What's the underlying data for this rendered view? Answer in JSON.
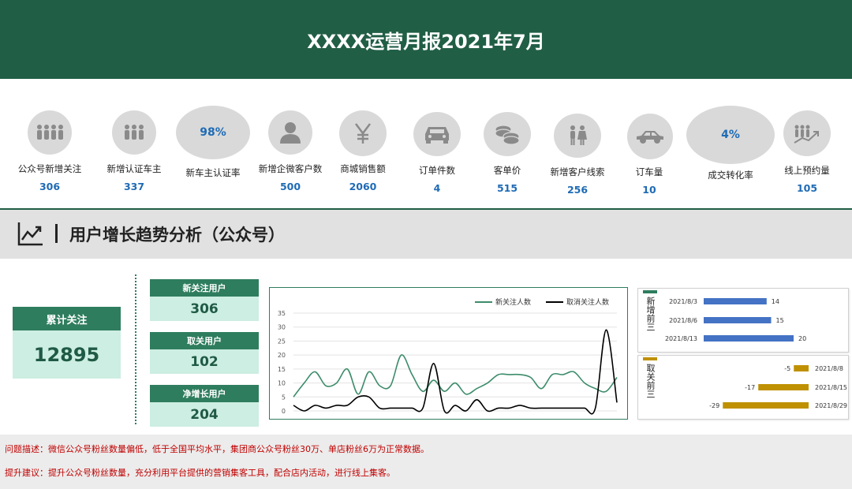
{
  "header": {
    "title": "XXXX运营月报2021年7月"
  },
  "kpis": [
    {
      "label": "公众号新增关注",
      "value": "306",
      "icon": "people-group-icon"
    },
    {
      "label": "新增认证车主",
      "value": "337",
      "icon": "people-group-icon"
    },
    {
      "label": "新车主认证率",
      "value": "98%",
      "icon": "percent-bubble"
    },
    {
      "label": "新增企微客户数",
      "value": "500",
      "icon": "user-icon"
    },
    {
      "label": "商城销售额",
      "value": "2060",
      "icon": "yen-icon"
    },
    {
      "label": "订单件数",
      "value": "4",
      "icon": "car-front-icon"
    },
    {
      "label": "客单价",
      "value": "515",
      "icon": "coins-icon"
    },
    {
      "label": "新增客户线索",
      "value": "256",
      "icon": "couple-icon"
    },
    {
      "label": "订车量",
      "value": "10",
      "icon": "car-side-icon"
    },
    {
      "label": "成交转化率",
      "value": "4%",
      "icon": "percent-bubble"
    },
    {
      "label": "线上预约量",
      "value": "105",
      "icon": "growth-people-icon"
    }
  ],
  "section": {
    "title": "用户增长趋势分析（公众号）"
  },
  "total": {
    "label": "累计关注",
    "value": "12895"
  },
  "mini": [
    {
      "label": "新关注用户",
      "value": "306"
    },
    {
      "label": "取关用户",
      "value": "102"
    },
    {
      "label": "净增长用户",
      "value": "204"
    }
  ],
  "notes": {
    "problem": "问题描述：微信公众号粉丝数量偏低，低于全国平均水平，集团商公众号粉丝30万、单店粉丝6万为正常数据。",
    "suggestion": "提升建议：提升公众号粉丝数量，充分利用平台提供的营销集客工具，配合店内活动，进行线上集客。"
  },
  "colors": {
    "brand": "#215e46",
    "accent_green": "#2e7d5e",
    "light_green": "#cdeee2",
    "value_blue": "#1f6bb5",
    "note_red": "#c00000",
    "bar_blue": "#4472c4",
    "bar_gold": "#bf9000"
  },
  "chart_data": [
    {
      "type": "line",
      "title": "",
      "ylim": [
        0,
        35
      ],
      "yticks": [
        "0",
        "5",
        "10",
        "15",
        "20",
        "25",
        "30",
        "35"
      ],
      "x": [
        1,
        2,
        3,
        4,
        5,
        6,
        7,
        8,
        9,
        10,
        11,
        12,
        13,
        14,
        15,
        16,
        17,
        18,
        19,
        20,
        21,
        22,
        23,
        24,
        25,
        26,
        27,
        28,
        29,
        30,
        31
      ],
      "series": [
        {
          "name": "新关注人数",
          "color": "#3d8c6b",
          "values": [
            5,
            10,
            14,
            9,
            10,
            15,
            6,
            14,
            9,
            9,
            20,
            13,
            7,
            11,
            7,
            10,
            6,
            8,
            10,
            13,
            13,
            13,
            12,
            8,
            13,
            13,
            14,
            10,
            8,
            7,
            12
          ]
        },
        {
          "name": "取消关注人数",
          "color": "#000000",
          "values": [
            2,
            0,
            2,
            1,
            2,
            2,
            5,
            5,
            1,
            1,
            1,
            1,
            1,
            17,
            0,
            2,
            0,
            4,
            0,
            1,
            1,
            2,
            1,
            1,
            1,
            1,
            1,
            1,
            1,
            29,
            3
          ]
        }
      ]
    },
    {
      "type": "bar",
      "orientation": "horizontal",
      "group_label": "新增前三",
      "categories": [
        "2021/8/3",
        "2021/8/6",
        "2021/8/13"
      ],
      "values": [
        14,
        15,
        20
      ],
      "color": "#4472c4"
    },
    {
      "type": "bar",
      "orientation": "horizontal",
      "group_label": "取关前三",
      "categories": [
        "2021/8/8",
        "2021/8/15",
        "2021/8/29"
      ],
      "values": [
        -5,
        -17,
        -29
      ],
      "color": "#bf9000"
    }
  ]
}
